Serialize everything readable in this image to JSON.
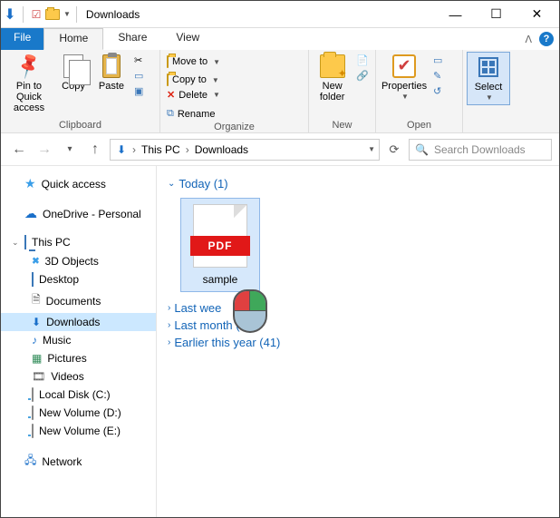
{
  "window": {
    "title": "Downloads"
  },
  "tabs": {
    "file": "File",
    "home": "Home",
    "share": "Share",
    "view": "View"
  },
  "ribbon": {
    "clipboard": {
      "label": "Clipboard",
      "pin": "Pin to Quick access",
      "copy": "Copy",
      "paste": "Paste"
    },
    "organize": {
      "label": "Organize",
      "moveto": "Move to",
      "copyto": "Copy to",
      "delete": "Delete",
      "rename": "Rename"
    },
    "new": {
      "label": "New",
      "newfolder": "New folder"
    },
    "open": {
      "label": "Open",
      "properties": "Properties"
    },
    "select": {
      "select": "Select"
    }
  },
  "breadcrumb": {
    "root": "This PC",
    "current": "Downloads"
  },
  "search": {
    "placeholder": "Search Downloads"
  },
  "sidebar": {
    "quick": "Quick access",
    "onedrive": "OneDrive - Personal",
    "thispc": "This PC",
    "items": [
      "3D Objects",
      "Desktop",
      "Documents",
      "Downloads",
      "Music",
      "Pictures",
      "Videos",
      "Local Disk (C:)",
      "New Volume (D:)",
      "New Volume (E:)"
    ],
    "network": "Network"
  },
  "groups": {
    "today": "Today (1)",
    "lastweek": "Last wee",
    "lastmonth": "Last month (10)",
    "earlier": "Earlier this year (41)"
  },
  "file": {
    "name": "sample",
    "badge": "PDF"
  }
}
